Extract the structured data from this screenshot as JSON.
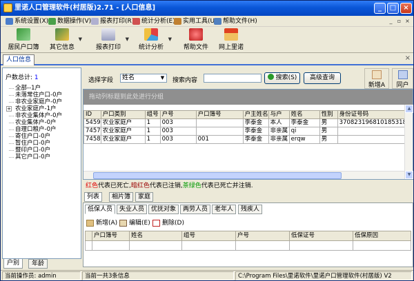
{
  "window": {
    "title": "里诺人口管理软件(村居版)2.71 - [人口信息]"
  },
  "menu": [
    "系统设置(X)",
    "数据操作(V)",
    "报表打印(R)",
    "统计分析(E)",
    "实用工具(U)",
    "帮助文件(H)"
  ],
  "toolbar": {
    "resident_book": "居民户口簿",
    "other_info": "其它信息",
    "report_print": "报表打印",
    "stat_analysis": "统计分析",
    "help_file": "帮助文件",
    "online": "网上里诺"
  },
  "tab": {
    "person_info": "人口信息",
    "close": "×"
  },
  "left": {
    "household_label": "户数总计:",
    "household_count": "1",
    "tree": [
      "全部--1户",
      "未落常住户口-0户",
      "非农业家庭户-0户",
      "农业家庭户-1户",
      "非农业集体户-0户",
      "农业集体户-0户",
      "自理口粮户-0户",
      "寄住户口-0户",
      "暂住户口-0户",
      "暨印户口-0户",
      "其它户口-0户"
    ],
    "tabs": [
      "户别",
      "年龄"
    ]
  },
  "search": {
    "field_label": "选择字段",
    "field_value": "姓名",
    "content_label": "搜索内容",
    "search_btn": "搜索(S)",
    "advanced_btn": "高级查询",
    "add_btn": "新增A",
    "household_btn": "同户"
  },
  "grid": {
    "group_hint": "拖动列标题到此处进行分组",
    "columns": [
      "ID",
      "户口类别",
      "组号",
      "户号",
      "户口簿号",
      "户主姓名",
      "与户",
      "姓名",
      "性别",
      "身份证号码"
    ],
    "rows": [
      [
        "5459",
        "农业家庭户",
        "1",
        "003",
        "",
        "李泰金",
        "本人",
        "李泰金",
        "男",
        "370823196810185318"
      ],
      [
        "7457",
        "农业家庭户",
        "1",
        "003",
        "",
        "李泰金",
        "非亲属",
        "qi",
        "男",
        ""
      ],
      [
        "7458",
        "农业家庭户",
        "1",
        "003",
        "001",
        "李泰金",
        "非亲属",
        "erqw",
        "男",
        ""
      ]
    ]
  },
  "legend": {
    "red": "红色",
    "t1": "代表已死亡,",
    "darkred": "暗红色",
    "t2": "代表已注销,",
    "green": "茶绿色",
    "t3": "代表已死亡并注销."
  },
  "subtabs": [
    "列表",
    "相片簿",
    "家庭"
  ],
  "bottom": {
    "tabs": [
      "低保人员",
      "失业人员",
      "优抚对象",
      "两劳人员",
      "老年人",
      "残疾人"
    ],
    "add": "新增(A)",
    "edit": "编辑(E)",
    "delete": "删除(D)",
    "columns": [
      "户口簿号",
      "姓名",
      "组号",
      "户号",
      "低保证号",
      "低保原因"
    ]
  },
  "status": {
    "operator": "当前操作员: admin",
    "count": "当前一共3条信息",
    "path": "C:\\Program Files\\里诺软件\\里诺户口管理软件(村居版) V2"
  }
}
